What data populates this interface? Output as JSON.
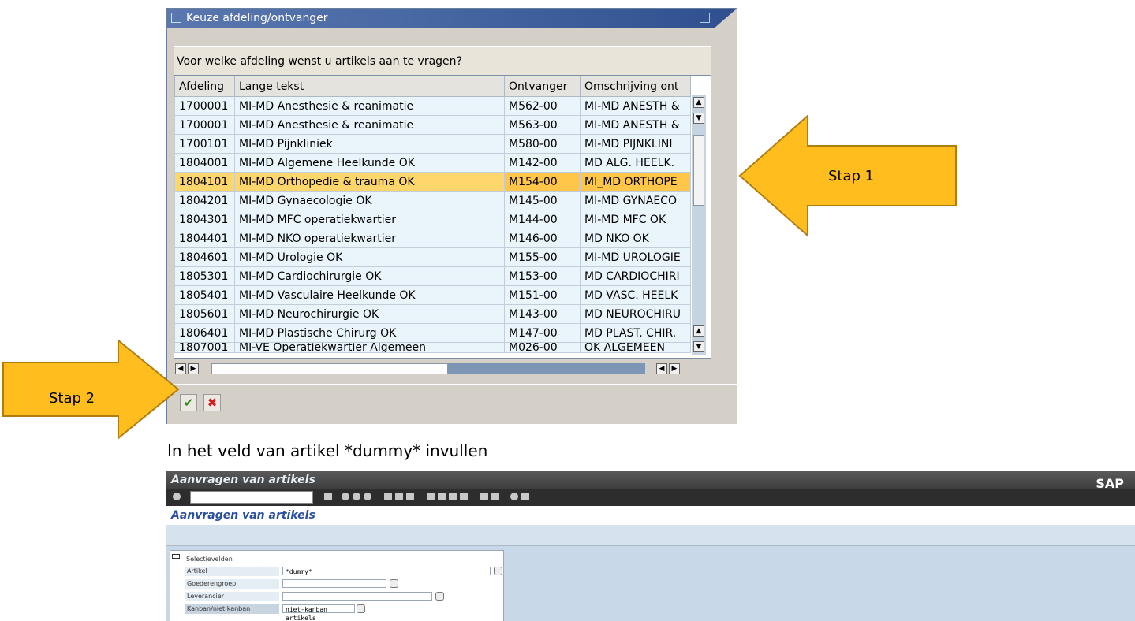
{
  "dialog": {
    "title": "Keuze afdeling/ontvanger",
    "question": "Voor welke afdeling wenst u artikels aan te vragen?",
    "columns": [
      "Afdeling",
      "Lange tekst",
      "Ontvanger",
      "Omschrijving ont"
    ],
    "rows": [
      {
        "afdeling": "1700001",
        "tekst": "MI-MD Anesthesie & reanimatie",
        "ontvanger": "M562-00",
        "oms": "MI-MD ANESTH &"
      },
      {
        "afdeling": "1700001",
        "tekst": "MI-MD Anesthesie & reanimatie",
        "ontvanger": "M563-00",
        "oms": "MI-MD ANESTH &"
      },
      {
        "afdeling": "1700101",
        "tekst": "MI-MD Pijnkliniek",
        "ontvanger": "M580-00",
        "oms": "MI-MD PIJNKLINI"
      },
      {
        "afdeling": "1804001",
        "tekst": "MI-MD Algemene Heelkunde OK",
        "ontvanger": "M142-00",
        "oms": "MD ALG. HEELK."
      },
      {
        "afdeling": "1804101",
        "tekst": "MI-MD Orthopedie & trauma OK",
        "ontvanger": "M154-00",
        "oms": "MI_MD ORTHOPE"
      },
      {
        "afdeling": "1804201",
        "tekst": "MI-MD Gynaecologie  OK",
        "ontvanger": "M145-00",
        "oms": "MI-MD GYNAECO"
      },
      {
        "afdeling": "1804301",
        "tekst": "MI-MD MFC operatiekwartier",
        "ontvanger": "M144-00",
        "oms": "MI-MD MFC OK"
      },
      {
        "afdeling": "1804401",
        "tekst": "MI-MD NKO  operatiekwartier",
        "ontvanger": "M146-00",
        "oms": "MD NKO OK"
      },
      {
        "afdeling": "1804601",
        "tekst": "MI-MD Urologie OK",
        "ontvanger": "M155-00",
        "oms": "MI-MD UROLOGIE"
      },
      {
        "afdeling": "1805301",
        "tekst": "MI-MD Cardiochirurgie OK",
        "ontvanger": "M153-00",
        "oms": "MD CARDIOCHIRI"
      },
      {
        "afdeling": "1805401",
        "tekst": "MI-MD Vasculaire Heelkunde OK",
        "ontvanger": "M151-00",
        "oms": "MD VASC. HEELK"
      },
      {
        "afdeling": "1805601",
        "tekst": "MI-MD Neurochirurgie OK",
        "ontvanger": "M143-00",
        "oms": "MD NEUROCHIRU"
      },
      {
        "afdeling": "1806401",
        "tekst": "MI-MD Plastische Chirurg OK",
        "ontvanger": "M147-00",
        "oms": "MD PLAST. CHIR."
      },
      {
        "afdeling": "1807001",
        "tekst": "MI-VE Operatiekwartier Algemeen",
        "ontvanger": "M026-00",
        "oms": "OK ALGEMEEN"
      }
    ],
    "selected_row": 4
  },
  "annotations": {
    "step1": "Stap 1",
    "step2": "Stap 2",
    "caption": "In het veld van artikel *dummy* invullen"
  },
  "sap": {
    "window_title": "Aanvragen van artikels",
    "logo": "SAP",
    "screen_title": "Aanvragen van artikels",
    "panel_tab": "Selectievelden",
    "fields": [
      {
        "label": "Artikel",
        "value": "*dummy*"
      },
      {
        "label": "Goederengroep",
        "value": ""
      },
      {
        "label": "Leverancier",
        "value": ""
      },
      {
        "label": "Kanban/niet kanban",
        "value": "niet-kanban artikels"
      }
    ]
  },
  "colors": {
    "selected_row": "#ffd66b",
    "arrow": "#ffbe1e",
    "title_bar": "#4a6aa5"
  }
}
